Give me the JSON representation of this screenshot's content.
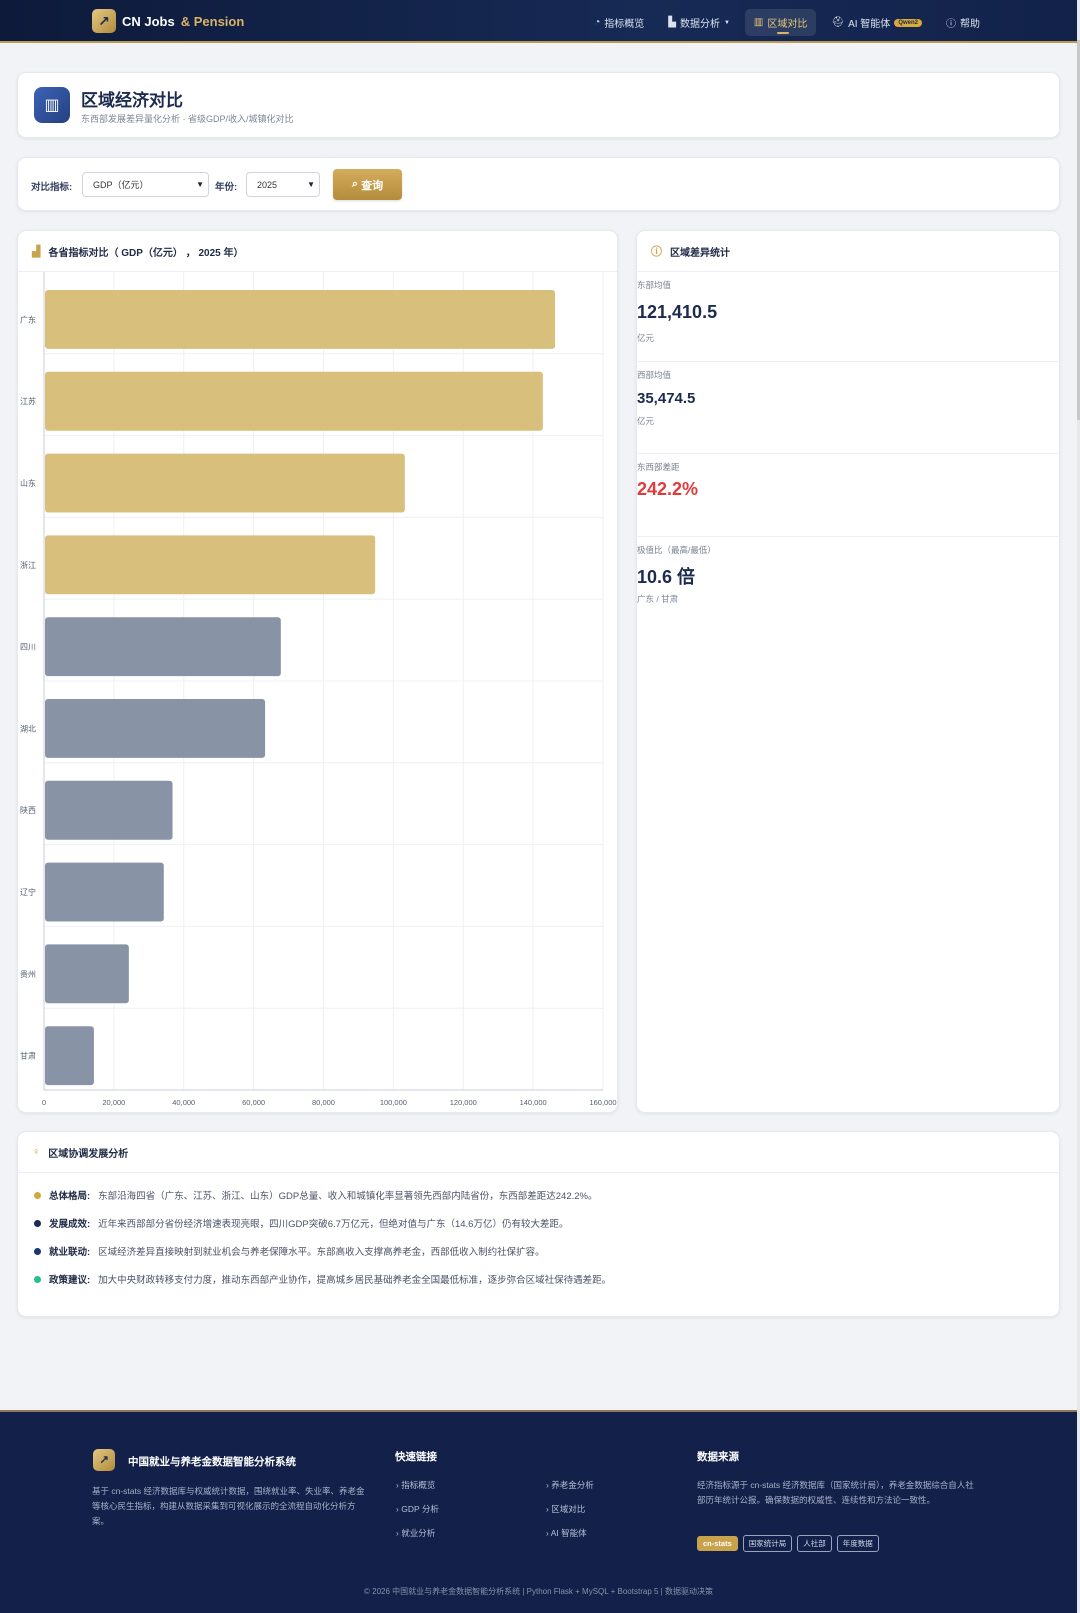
{
  "nav": {
    "brand": "CN Jobs",
    "brand_accent": "& Pension",
    "items": [
      {
        "icon": "dashboard-icon",
        "glyph": "◔",
        "label": "指标概览"
      },
      {
        "icon": "bar-chart-icon",
        "glyph": "▙",
        "label": "数据分析",
        "dropdown": true
      },
      {
        "icon": "columns-icon",
        "glyph": "▥",
        "label": "区域对比",
        "active": true
      },
      {
        "icon": "robot-icon",
        "glyph": "⛑",
        "label": "AI 智能体",
        "badge": "Qwen2"
      },
      {
        "icon": "help-icon",
        "glyph": "ⓘ",
        "label": "帮助"
      }
    ]
  },
  "header": {
    "title": "区域经济对比",
    "subtitle": "东西部发展差异量化分析 · 省级GDP/收入/城镇化对比"
  },
  "filter": {
    "indicator_label": "对比指标:",
    "indicator_value": "GDP（亿元）",
    "year_label": "年份:",
    "year_value": "2025",
    "query_label": "查询"
  },
  "chart_panel": {
    "title": "各省指标对比（ GDP（亿元） ， 2025 年）"
  },
  "chart_data": {
    "type": "bar",
    "orientation": "horizontal",
    "categories": [
      "广东",
      "江苏",
      "山东",
      "浙江",
      "四川",
      "湖北",
      "陕西",
      "辽宁",
      "贵州",
      "甘肃"
    ],
    "values": [
      146000,
      142500,
      103000,
      94500,
      67500,
      63000,
      36500,
      34000,
      24000,
      14000
    ],
    "region_group": [
      "east",
      "east",
      "east",
      "east",
      "west",
      "west",
      "west",
      "west",
      "west",
      "west"
    ],
    "colors": {
      "east": "#d8c07c",
      "west": "#8993a6"
    },
    "xlim": [
      0,
      160000
    ],
    "xticks": [
      "0",
      "20,000",
      "40,000",
      "60,000",
      "80,000",
      "100,000",
      "120,000",
      "140,000",
      "160,000"
    ],
    "grid": true
  },
  "stats_panel": {
    "title": "区域差异统计",
    "items": [
      {
        "label": "东部均值",
        "value": "121,410.5",
        "unit": "亿元",
        "color": "#1b2a4e"
      },
      {
        "label": "西部均值",
        "value": "35,474.5",
        "unit": "亿元",
        "color": "#1b2a4e"
      },
      {
        "label": "东西部差距",
        "value": "242.2%",
        "unit": "",
        "color": "#e03b3b"
      },
      {
        "label": "极值比（最高/最低）",
        "value": "10.6 倍",
        "unit": "广东 / 甘肃",
        "color": "#1b2a4e"
      }
    ]
  },
  "analysis": {
    "title": "区域协调发展分析",
    "rows": [
      {
        "color": "#d4a83a",
        "label": "总体格局:",
        "text": "东部沿海四省（广东、江苏、浙江、山东）GDP总量、收入和城镇化率显著领先西部内陆省份，东西部差距达242.2%。"
      },
      {
        "color": "#1b2a4e",
        "label": "发展成效:",
        "text": "近年来西部部分省份经济增速表现亮眼，四川GDP突破6.7万亿元，但绝对值与广东（14.6万亿）仍有较大差距。"
      },
      {
        "color": "#1b3570",
        "label": "就业联动:",
        "text": "区域经济差异直接映射到就业机会与养老保障水平。东部高收入支撑高养老金，西部低收入制约社保扩容。"
      },
      {
        "color": "#22c08a",
        "label": "政策建议:",
        "text": "加大中央财政转移支付力度，推动东西部产业协作，提高城乡居民基础养老金全国最低标准，逐步弥合区域社保待遇差距。"
      }
    ]
  },
  "footer": {
    "brand_title": "中国就业与养老金数据智能分析系统",
    "brand_desc": "基于 cn-stats 经济数据库与权威统计数据，围绕就业率、失业率、养老金等核心民生指标，构建从数据采集到可视化展示的全流程自动化分析方案。",
    "links_title": "快速链接",
    "links": [
      "指标概览",
      "GDP 分析",
      "就业分析",
      "养老金分析",
      "区域对比",
      "AI 智能体"
    ],
    "source_title": "数据来源",
    "source_desc": "经济指标源于 cn-stats 经济数据库（国家统计局），养老金数据综合自人社部历年统计公报。确保数据的权威性、连续性和方法论一致性。",
    "tags": [
      "cn-stats",
      "国家统计局",
      "人社部",
      "年度数据"
    ],
    "copyright": "© 2026 中国就业与养老金数据智能分析系统 | Python Flask + MySQL + Bootstrap 5 | 数据驱动决策"
  }
}
